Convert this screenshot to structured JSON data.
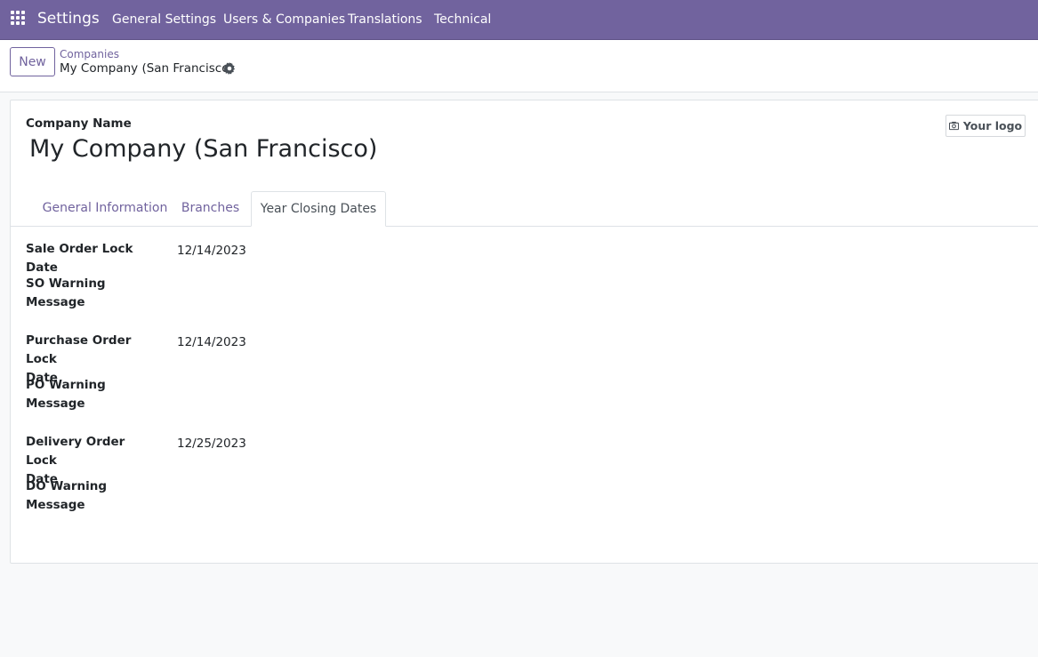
{
  "navbar": {
    "app_name": "Settings",
    "menus": [
      "General Settings",
      "Users & Companies",
      "Translations",
      "Technical"
    ]
  },
  "control_panel": {
    "new_label": "New",
    "breadcrumb_parent": "Companies",
    "breadcrumb_current": "My Company (San Francisco)"
  },
  "form": {
    "company_name_label": "Company Name",
    "company_name": "My Company (San Francisco)",
    "logo_label": "Your logo",
    "tabs": [
      "General Information",
      "Branches",
      "Year Closing Dates"
    ],
    "active_tab": "Year Closing Dates",
    "fields": {
      "sale_lock_label": "Sale Order Lock Date",
      "sale_lock_value": "12/14/2023",
      "so_warning_label": "SO Warning Message",
      "purchase_lock_label_1": "Purchase Order Lock",
      "purchase_lock_label_2": "Date",
      "purchase_lock_value": "12/14/2023",
      "po_warning_label": "PO Warning Message",
      "delivery_lock_label_1": "Delivery Order Lock",
      "delivery_lock_label_2": "Date",
      "delivery_lock_value": "12/25/2023",
      "do_warning_label": "DO Warning Message"
    }
  },
  "colors": {
    "brand": "#71639e",
    "text": "#212529",
    "background": "#f8f9fa"
  },
  "icons": {
    "apps": "apps-grid-icon",
    "gear": "gear-icon",
    "camera": "camera-icon"
  }
}
